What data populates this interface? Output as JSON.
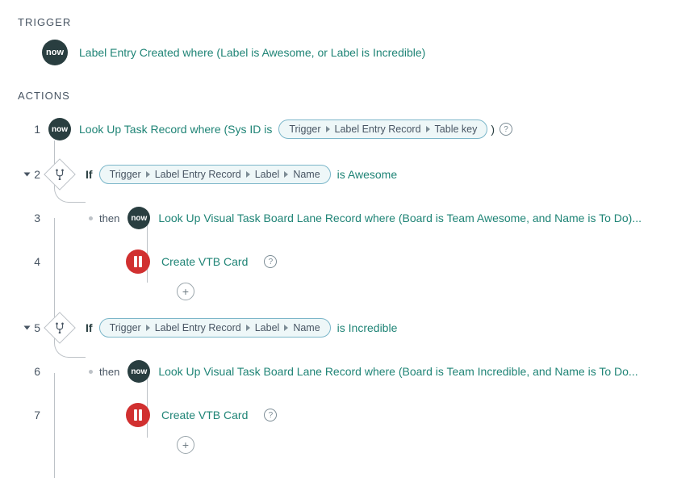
{
  "sections": {
    "trigger": "TRIGGER",
    "actions": "ACTIONS"
  },
  "now_label": "now",
  "trigger_text": "Label Entry Created where (Label is Awesome, or Label is Incredible)",
  "pill_segments": {
    "sysid": [
      "Trigger",
      "Label Entry Record",
      "Table key"
    ],
    "name": [
      "Trigger",
      "Label Entry Record",
      "Label",
      "Name"
    ]
  },
  "action1": {
    "num": "1",
    "prefix": "Look Up Task Record where (Sys ID is",
    "suffix": ")",
    "close_paren": ")"
  },
  "if1": {
    "num": "2",
    "if": "If",
    "after": "is Awesome"
  },
  "then_label": "then",
  "action3": {
    "num": "3",
    "text": "Look Up Visual Task Board Lane Record where (Board is Team Awesome, and Name is To Do)..."
  },
  "action4": {
    "num": "4",
    "text": "Create VTB Card"
  },
  "if2": {
    "num": "5",
    "if": "If",
    "after": "is Incredible"
  },
  "action6": {
    "num": "6",
    "text": "Look Up Visual Task Board Lane Record where (Board is Team Incredible, and Name is To Do..."
  },
  "action7": {
    "num": "7",
    "text": "Create VTB Card"
  },
  "info_glyph": "?",
  "plus_glyph": "+"
}
